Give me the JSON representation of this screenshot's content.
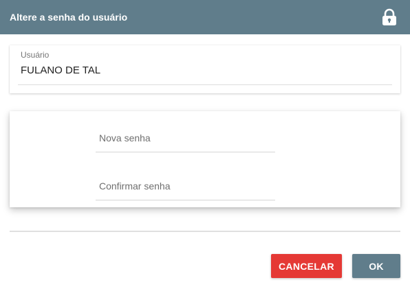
{
  "header": {
    "title": "Altere a senha do usuário",
    "icon": "lock-icon"
  },
  "user": {
    "label": "Usuário",
    "value": "FULANO DE TAL"
  },
  "password_form": {
    "new_password_placeholder": "Nova senha",
    "confirm_password_placeholder": "Confirmar senha"
  },
  "actions": {
    "cancel_label": "CANCELAR",
    "ok_label": "OK"
  },
  "colors": {
    "header_bg": "#607d8b",
    "cancel_bg": "#e53935",
    "ok_bg": "#607d8b"
  }
}
